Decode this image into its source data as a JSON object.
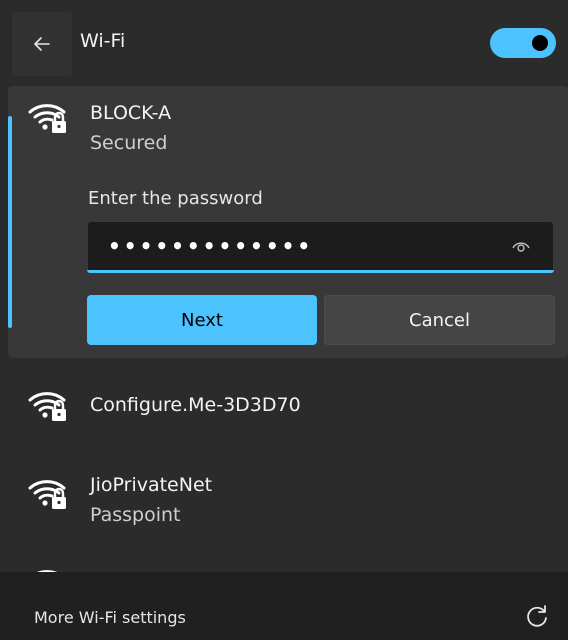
{
  "header": {
    "title": "Wi-Fi",
    "back_icon": "back-arrow-icon",
    "wifi_enabled": true
  },
  "networks": [
    {
      "name": "BLOCK-A",
      "status": "Secured",
      "icon": "wifi-secured-icon",
      "expanded": true
    },
    {
      "name": "Configure.Me-3D3D70",
      "status": "",
      "icon": "wifi-secured-icon"
    },
    {
      "name": "JioPrivateNet",
      "status": "Passpoint",
      "icon": "wifi-secured-icon"
    }
  ],
  "password": {
    "label": "Enter the password",
    "masked_value": "•••••••••••••",
    "reveal_icon": "eye-icon"
  },
  "buttons": {
    "next": "Next",
    "cancel": "Cancel"
  },
  "footer": {
    "link": "More Wi-Fi settings",
    "refresh_icon": "refresh-icon"
  },
  "colors": {
    "accent": "#4cc2ff",
    "panel_bg": "#2b2b2b",
    "card_bg": "#383838",
    "footer_bg": "#202020"
  }
}
